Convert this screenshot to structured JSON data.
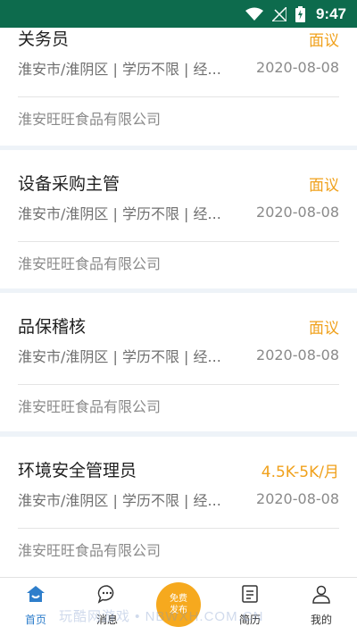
{
  "status_bar": {
    "time": "9:47"
  },
  "jobs": [
    {
      "title": "关务员",
      "salary": "面议",
      "meta": "淮安市/淮阴区 | 学历不限 | 经...",
      "date": "2020-08-08",
      "company": "淮安旺旺食品有限公司"
    },
    {
      "title": "设备采购主管",
      "salary": "面议",
      "meta": "淮安市/淮阴区 | 学历不限 | 经...",
      "date": "2020-08-08",
      "company": "淮安旺旺食品有限公司"
    },
    {
      "title": "品保稽核",
      "salary": "面议",
      "meta": "淮安市/淮阴区 | 学历不限 | 经...",
      "date": "2020-08-08",
      "company": "淮安旺旺食品有限公司"
    },
    {
      "title": "环境安全管理员",
      "salary": "4.5K-5K/月",
      "meta": "淮安市/淮阴区 | 学历不限 | 经...",
      "date": "2020-08-08",
      "company": "淮安旺旺食品有限公司"
    }
  ],
  "tabs": [
    {
      "label": "首页",
      "icon": "home-icon",
      "active": true
    },
    {
      "label": "消息",
      "icon": "message-icon"
    },
    {
      "label": "简历",
      "icon": "resume-icon"
    },
    {
      "label": "我的",
      "icon": "profile-icon"
    }
  ],
  "publish": {
    "line1": "免费",
    "line2": "发布"
  },
  "watermark": "玩酷网游戏 • NBWXH.COM.CN",
  "colors": {
    "status_bar": "#0d6b4d",
    "salary": "#f0a11c",
    "active_tab": "#2e7ecb",
    "publish_button": "#f6a91e"
  }
}
